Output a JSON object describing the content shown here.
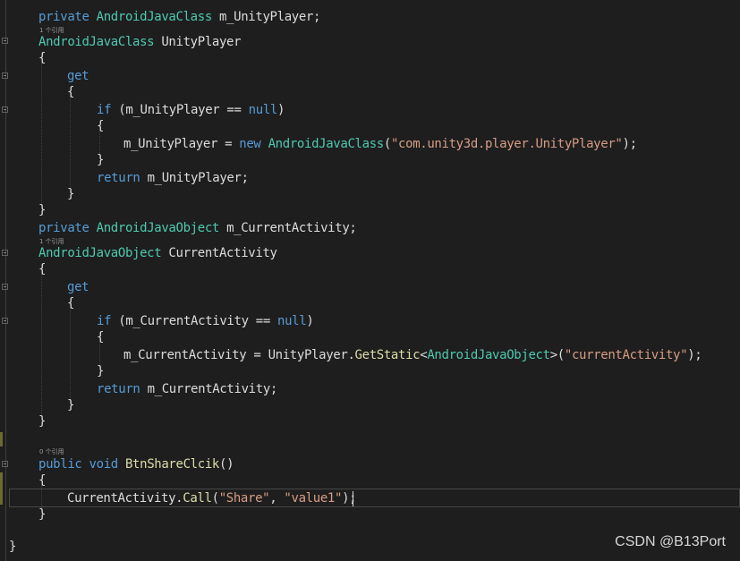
{
  "editor": {
    "lines": [
      {
        "name": "field-unityplayer-line",
        "tokens": [
          [
            "kw",
            "private "
          ],
          [
            "ty",
            "AndroidJavaClass"
          ],
          [
            "pl",
            " m_UnityPlayer;"
          ]
        ]
      },
      {
        "name": "prop-unityplayer-line",
        "tokens": [
          [
            "ty",
            "AndroidJavaClass"
          ],
          [
            "pl",
            " UnityPlayer"
          ]
        ]
      },
      {
        "name": "brace-line",
        "tokens": [
          [
            "pl",
            "{"
          ]
        ]
      },
      {
        "name": "get-line",
        "tokens": [
          [
            "kw",
            "get"
          ]
        ]
      },
      {
        "name": "brace-line",
        "tokens": [
          [
            "pl",
            "{"
          ]
        ]
      },
      {
        "name": "if-line",
        "tokens": [
          [
            "kw",
            "if"
          ],
          [
            "pl",
            " (m_UnityPlayer == "
          ],
          [
            "kw",
            "null"
          ],
          [
            "pl",
            ")"
          ]
        ]
      },
      {
        "name": "brace-line",
        "tokens": [
          [
            "pl",
            "{"
          ]
        ]
      },
      {
        "name": "assign-line",
        "tokens": [
          [
            "pl",
            "m_UnityPlayer = "
          ],
          [
            "kw",
            "new "
          ],
          [
            "ty",
            "AndroidJavaClass"
          ],
          [
            "pl",
            "("
          ],
          [
            "str",
            "\"com.unity3d.player.UnityPlayer\""
          ],
          [
            "pl",
            ");"
          ]
        ]
      },
      {
        "name": "brace-line",
        "tokens": [
          [
            "pl",
            "}"
          ]
        ]
      },
      {
        "name": "return-line",
        "tokens": [
          [
            "kw",
            "return"
          ],
          [
            "pl",
            " m_UnityPlayer;"
          ]
        ]
      },
      {
        "name": "brace-line",
        "tokens": [
          [
            "pl",
            "}"
          ]
        ]
      },
      {
        "name": "brace-line",
        "tokens": [
          [
            "pl",
            "}"
          ]
        ]
      },
      {
        "name": "field-currentactivity-line",
        "tokens": [
          [
            "kw",
            "private "
          ],
          [
            "ty",
            "AndroidJavaObject"
          ],
          [
            "pl",
            " m_CurrentActivity;"
          ]
        ]
      },
      {
        "name": "prop-currentactivity-line",
        "tokens": [
          [
            "ty",
            "AndroidJavaObject"
          ],
          [
            "pl",
            " CurrentActivity"
          ]
        ]
      },
      {
        "name": "brace-line",
        "tokens": [
          [
            "pl",
            "{"
          ]
        ]
      },
      {
        "name": "get-line",
        "tokens": [
          [
            "kw",
            "get"
          ]
        ]
      },
      {
        "name": "brace-line",
        "tokens": [
          [
            "pl",
            "{"
          ]
        ]
      },
      {
        "name": "if-line",
        "tokens": [
          [
            "kw",
            "if"
          ],
          [
            "pl",
            " (m_CurrentActivity == "
          ],
          [
            "kw",
            "null"
          ],
          [
            "pl",
            ")"
          ]
        ]
      },
      {
        "name": "brace-line",
        "tokens": [
          [
            "pl",
            "{"
          ]
        ]
      },
      {
        "name": "assign-line",
        "tokens": [
          [
            "pl",
            "m_CurrentActivity = UnityPlayer."
          ],
          [
            "fn",
            "GetStatic"
          ],
          [
            "pl",
            "<"
          ],
          [
            "ty",
            "AndroidJavaObject"
          ],
          [
            "pl",
            ">("
          ],
          [
            "str",
            "\"currentActivity\""
          ],
          [
            "pl",
            ");"
          ]
        ]
      },
      {
        "name": "brace-line",
        "tokens": [
          [
            "pl",
            "}"
          ]
        ]
      },
      {
        "name": "return-line",
        "tokens": [
          [
            "kw",
            "return"
          ],
          [
            "pl",
            " m_CurrentActivity;"
          ]
        ]
      },
      {
        "name": "brace-line",
        "tokens": [
          [
            "pl",
            "}"
          ]
        ]
      },
      {
        "name": "brace-line",
        "tokens": [
          [
            "pl",
            "}"
          ]
        ]
      },
      {
        "name": "method-line",
        "tokens": [
          [
            "kw",
            "public void "
          ],
          [
            "fn",
            "BtnShareClcik"
          ],
          [
            "pl",
            "()"
          ]
        ]
      },
      {
        "name": "brace-line",
        "tokens": [
          [
            "pl",
            "{"
          ]
        ]
      },
      {
        "name": "call-line",
        "tokens": [
          [
            "pl",
            "CurrentActivity."
          ],
          [
            "fn",
            "Call"
          ],
          [
            "pl",
            "("
          ],
          [
            "str",
            "\"Share\""
          ],
          [
            "pl",
            ", "
          ],
          [
            "str",
            "\"value1\""
          ],
          [
            "pl",
            ");"
          ]
        ]
      },
      {
        "name": "brace-line",
        "tokens": [
          [
            "pl",
            "}"
          ]
        ]
      },
      {
        "name": "brace-line",
        "tokens": [
          [
            "pl",
            "}"
          ]
        ]
      }
    ],
    "codelens": [
      "1 个引用",
      "1 个引用",
      "0 个引用"
    ]
  },
  "watermark": "CSDN @B13Port",
  "colors": {
    "background": "#1e1e1e",
    "keyword": "#569cd6",
    "type": "#4ec9b0",
    "string": "#d69d85",
    "method": "#dcdcaa",
    "plain": "#dcdcdc"
  }
}
